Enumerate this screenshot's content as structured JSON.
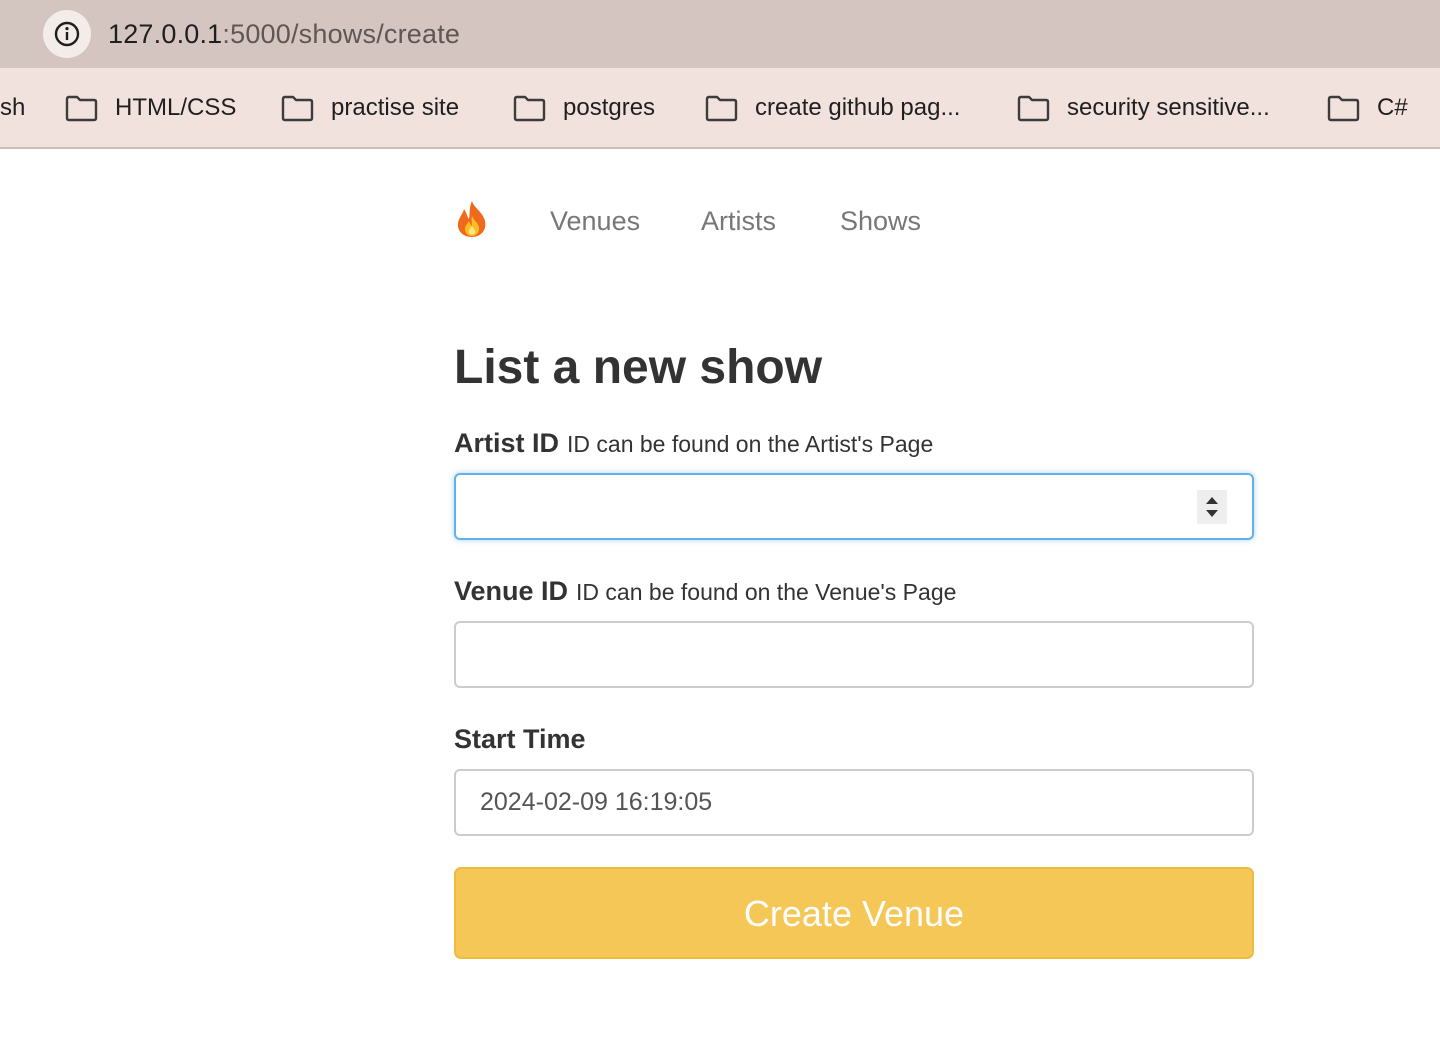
{
  "browser": {
    "url_host": "127.0.0.1",
    "url_rest": ":5000/shows/create",
    "info_icon": "info-icon"
  },
  "bookmarks": [
    {
      "label": "sh",
      "icon": "none"
    },
    {
      "label": "HTML/CSS",
      "icon": "folder-icon"
    },
    {
      "label": "practise site",
      "icon": "folder-icon"
    },
    {
      "label": "postgres",
      "icon": "folder-icon"
    },
    {
      "label": "create github pag...",
      "icon": "folder-icon"
    },
    {
      "label": "security sensitive...",
      "icon": "folder-icon"
    },
    {
      "label": "C#",
      "icon": "folder-icon"
    }
  ],
  "nav": {
    "logo_icon": "fire-icon",
    "links": [
      "Venues",
      "Artists",
      "Shows"
    ]
  },
  "form": {
    "title": "List a new show",
    "artist_id": {
      "label": "Artist ID",
      "hint": "ID can be found on the Artist's Page",
      "value": ""
    },
    "venue_id": {
      "label": "Venue ID",
      "hint": "ID can be found on the Venue's Page",
      "value": ""
    },
    "start_time": {
      "label": "Start Time",
      "value": "2024-02-09 16:19:05"
    },
    "submit_label": "Create Venue"
  },
  "colors": {
    "submit_bg": "#f5c757",
    "focus_border": "#66afe9",
    "bookmarks_bg": "#f2e2dd",
    "address_bg": "#d5c5c0"
  }
}
